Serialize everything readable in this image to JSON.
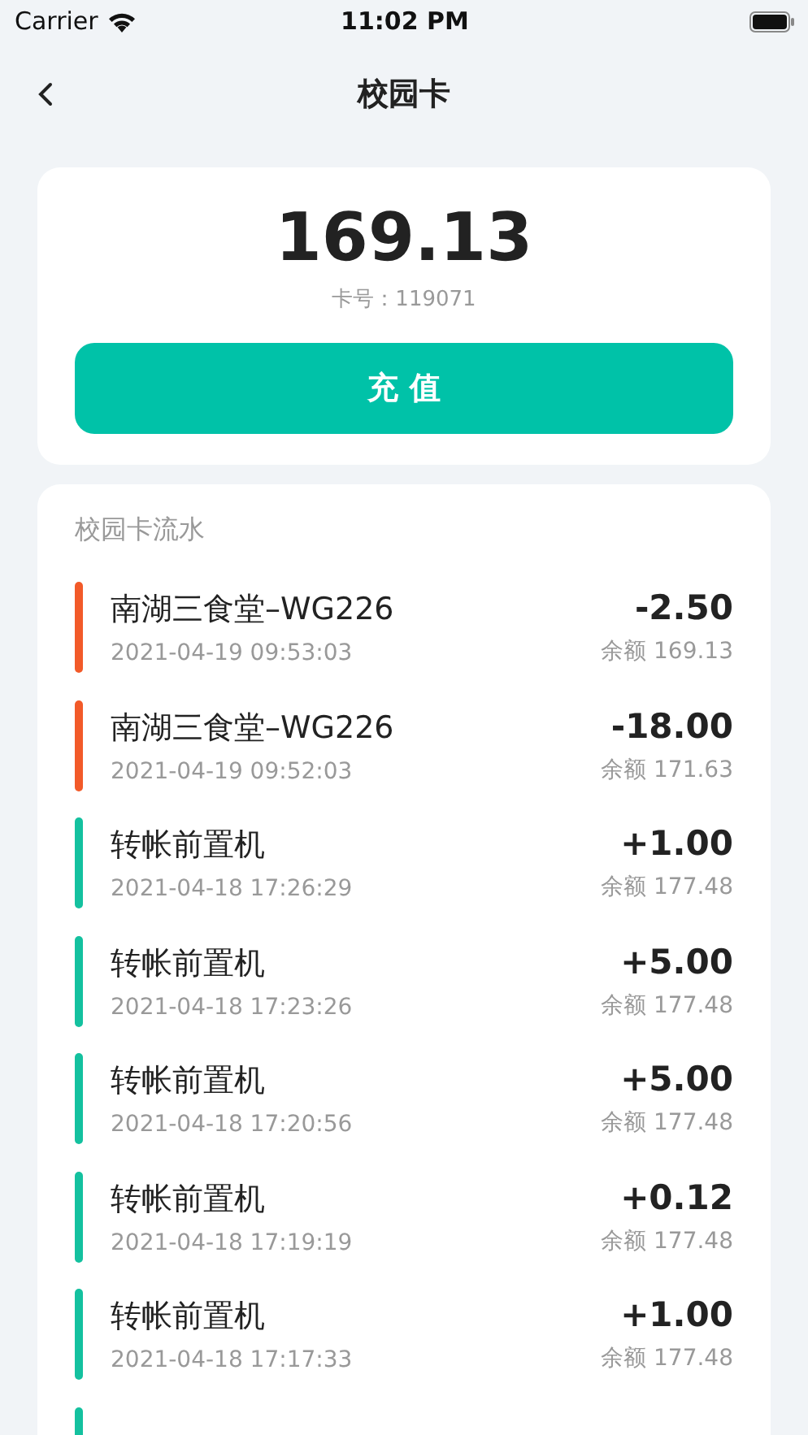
{
  "status_bar": {
    "carrier": "Carrier",
    "time": "11:02 PM"
  },
  "nav": {
    "title": "校园卡"
  },
  "card": {
    "balance": "169.13",
    "card_number": "卡号：119071",
    "button": "充 值"
  },
  "history": {
    "title": "校园卡流水",
    "items": [
      {
        "name": "南湖三食堂–WG226",
        "time": "2021-04-19 09:53:03",
        "amount": "-2.50",
        "balance": "余额 169.13",
        "color": "#f25a29"
      },
      {
        "name": "南湖三食堂–WG226",
        "time": "2021-04-19 09:52:03",
        "amount": "-18.00",
        "balance": "余额 171.63",
        "color": "#f25a29"
      },
      {
        "name": "转帐前置机",
        "time": "2021-04-18 17:26:29",
        "amount": "+1.00",
        "balance": "余额 177.48",
        "color": "#14c19f"
      },
      {
        "name": "转帐前置机",
        "time": "2021-04-18 17:23:26",
        "amount": "+5.00",
        "balance": "余额 177.48",
        "color": "#14c19f"
      },
      {
        "name": "转帐前置机",
        "time": "2021-04-18 17:20:56",
        "amount": "+5.00",
        "balance": "余额 177.48",
        "color": "#14c19f"
      },
      {
        "name": "转帐前置机",
        "time": "2021-04-18 17:19:19",
        "amount": "+0.12",
        "balance": "余额 177.48",
        "color": "#14c19f"
      },
      {
        "name": "转帐前置机",
        "time": "2021-04-18 17:17:33",
        "amount": "+1.00",
        "balance": "余额 177.48",
        "color": "#14c19f"
      },
      {
        "color": "#14c19f"
      }
    ]
  }
}
